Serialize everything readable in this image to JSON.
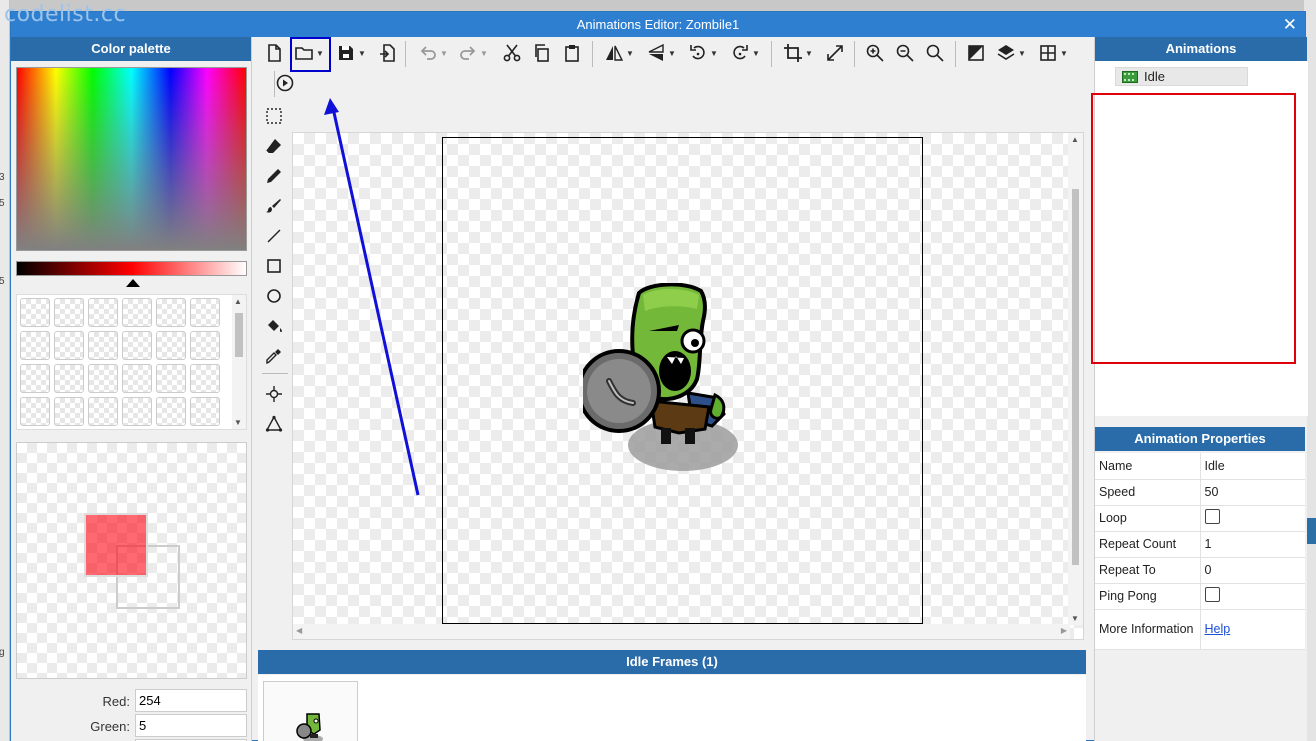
{
  "watermark": "codelist.cc",
  "background_fragments": [
    "3",
    "5",
    "5",
    "g"
  ],
  "window": {
    "title": "Animations Editor: Zombile1",
    "close_label": "✕"
  },
  "color_palette": {
    "title": "Color palette",
    "selected_color": "#fe0514",
    "rgb": {
      "red_label": "Red:",
      "red_value": "254",
      "green_label": "Green:",
      "green_value": "5"
    }
  },
  "toolbar": {
    "buttons": [
      "new",
      "open",
      "save",
      "export",
      "undo",
      "redo",
      "cut",
      "copy",
      "paste",
      "flip-horizontal",
      "flip-vertical",
      "rotate-left",
      "rotate-right",
      "crop",
      "resize",
      "zoom-in",
      "zoom-out",
      "zoom-reset",
      "toggle-background",
      "layers",
      "grid",
      "play"
    ]
  },
  "tools": [
    "marquee-select",
    "eraser",
    "pencil",
    "brush",
    "line",
    "rectangle",
    "ellipse",
    "paint-bucket",
    "color-picker",
    "origin-point",
    "polygon"
  ],
  "frames_panel": {
    "title": "Idle Frames (1)"
  },
  "animations": {
    "title": "Animations",
    "items": [
      {
        "label": "Idle"
      }
    ]
  },
  "properties": {
    "title": "Animation Properties",
    "name_label": "Name",
    "name_value": "Idle",
    "speed_label": "Speed",
    "speed_value": "50",
    "loop_label": "Loop",
    "repeat_count_label": "Repeat Count",
    "repeat_count_value": "1",
    "repeat_to_label": "Repeat To",
    "repeat_to_value": "0",
    "ping_pong_label": "Ping Pong",
    "more_info_label": "More Information",
    "help_link": "Help"
  },
  "annotation_colors": {
    "highlight": "#0000cc",
    "list_box": "#e0000a",
    "arrow": "#1010d8"
  }
}
